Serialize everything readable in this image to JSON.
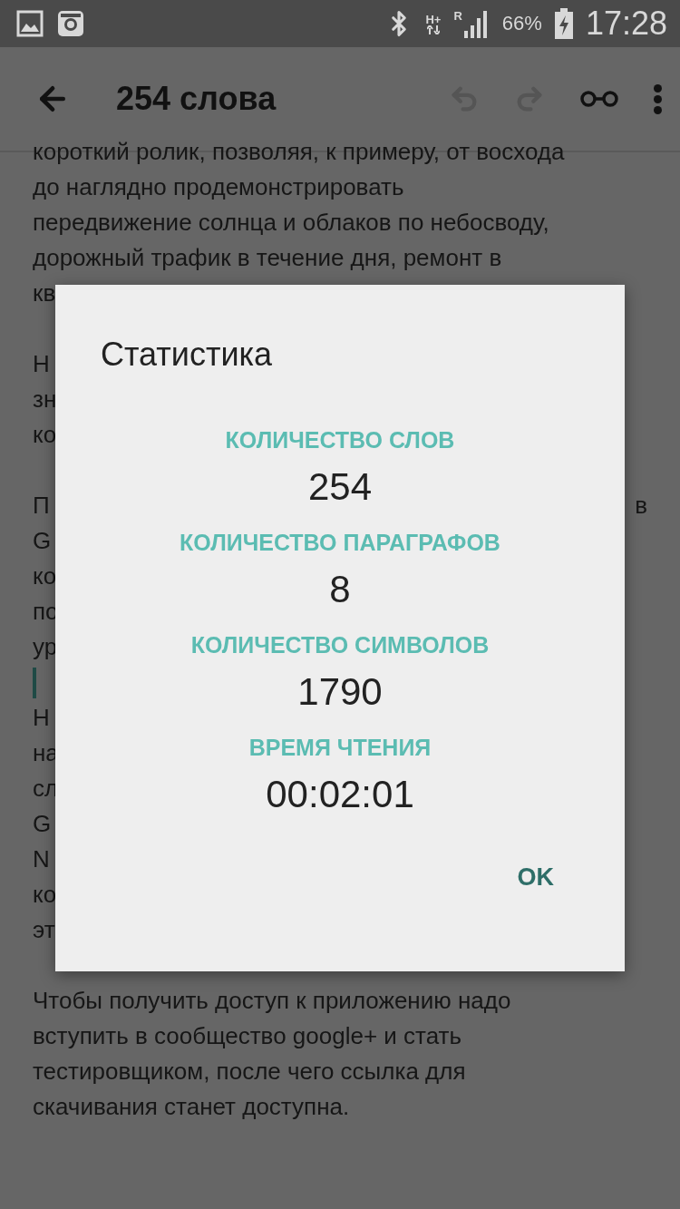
{
  "status_bar": {
    "network": "H+",
    "roaming": "R",
    "battery": "66%",
    "time": "17:28"
  },
  "toolbar": {
    "title": "254 слова",
    "actions": [
      {
        "kind": "undo",
        "disabled": true
      },
      {
        "kind": "redo",
        "disabled": true
      },
      {
        "kind": "read"
      },
      {
        "kind": "more"
      }
    ]
  },
  "document": {
    "lines": [
      {
        "kind": "text",
        "text": "короткий ролик, позволяя, к примеру, от восхода"
      },
      {
        "kind": "text",
        "text": "до  наглядно продемонстрировать"
      },
      {
        "kind": "text",
        "text": "передвижение солнца и облаков по небосводу,"
      },
      {
        "kind": "text",
        "text": "дорожный трафик в течение дня, ремонт в"
      },
      {
        "kind": "text",
        "text": "кв"
      },
      {
        "kind": "blank"
      },
      {
        "kind": "text",
        "text": "Н"
      },
      {
        "kind": "text",
        "text": "зн"
      },
      {
        "kind": "text",
        "text": "ко"
      },
      {
        "kind": "blank"
      },
      {
        "kind": "text",
        "text": "П",
        "right_text": "в"
      },
      {
        "kind": "text",
        "text": "G"
      },
      {
        "kind": "text",
        "text": "ко"
      },
      {
        "kind": "text",
        "text": "по"
      },
      {
        "kind": "text",
        "text": "ур"
      },
      {
        "kind": "cursor"
      },
      {
        "kind": "text",
        "text": "Н"
      },
      {
        "kind": "text",
        "text": "на"
      },
      {
        "kind": "text",
        "text": "сл"
      },
      {
        "kind": "text",
        "text": "G"
      },
      {
        "kind": "text",
        "text": "N"
      },
      {
        "kind": "text",
        "text": "ко"
      },
      {
        "kind": "text",
        "text": "эт"
      },
      {
        "kind": "blank"
      },
      {
        "kind": "text",
        "text": "Чтобы получить доступ к приложению надо"
      },
      {
        "kind": "text",
        "text": "вступить в сообщество google+ и стать"
      },
      {
        "kind": "text",
        "text": "тестировщиком, после чего ссылка для"
      },
      {
        "kind": "text",
        "text": "скачивания станет доступна."
      }
    ]
  },
  "dialog": {
    "title": "Статистика",
    "stats": [
      {
        "label": "КОЛИЧЕСТВО СЛОВ",
        "value": "254"
      },
      {
        "label": "КОЛИЧЕСТВО ПАРАГРАФОВ",
        "value": "8"
      },
      {
        "label": "КОЛИЧЕСТВО СИМВОЛОВ",
        "value": "1790"
      },
      {
        "label": "ВРЕМЯ ЧТЕНИЯ",
        "value": "00:02:01"
      }
    ],
    "button": "OK"
  }
}
